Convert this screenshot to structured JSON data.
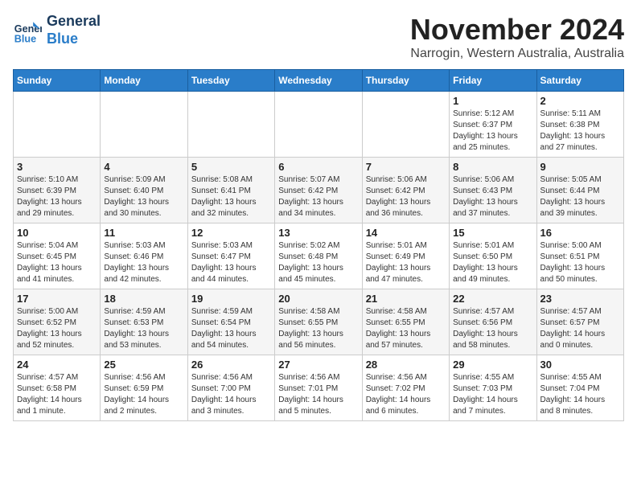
{
  "header": {
    "logo_line1": "General",
    "logo_line2": "Blue",
    "month": "November 2024",
    "location": "Narrogin, Western Australia, Australia"
  },
  "days_of_week": [
    "Sunday",
    "Monday",
    "Tuesday",
    "Wednesday",
    "Thursday",
    "Friday",
    "Saturday"
  ],
  "weeks": [
    [
      {
        "day": "",
        "info": ""
      },
      {
        "day": "",
        "info": ""
      },
      {
        "day": "",
        "info": ""
      },
      {
        "day": "",
        "info": ""
      },
      {
        "day": "",
        "info": ""
      },
      {
        "day": "1",
        "info": "Sunrise: 5:12 AM\nSunset: 6:37 PM\nDaylight: 13 hours\nand 25 minutes."
      },
      {
        "day": "2",
        "info": "Sunrise: 5:11 AM\nSunset: 6:38 PM\nDaylight: 13 hours\nand 27 minutes."
      }
    ],
    [
      {
        "day": "3",
        "info": "Sunrise: 5:10 AM\nSunset: 6:39 PM\nDaylight: 13 hours\nand 29 minutes."
      },
      {
        "day": "4",
        "info": "Sunrise: 5:09 AM\nSunset: 6:40 PM\nDaylight: 13 hours\nand 30 minutes."
      },
      {
        "day": "5",
        "info": "Sunrise: 5:08 AM\nSunset: 6:41 PM\nDaylight: 13 hours\nand 32 minutes."
      },
      {
        "day": "6",
        "info": "Sunrise: 5:07 AM\nSunset: 6:42 PM\nDaylight: 13 hours\nand 34 minutes."
      },
      {
        "day": "7",
        "info": "Sunrise: 5:06 AM\nSunset: 6:42 PM\nDaylight: 13 hours\nand 36 minutes."
      },
      {
        "day": "8",
        "info": "Sunrise: 5:06 AM\nSunset: 6:43 PM\nDaylight: 13 hours\nand 37 minutes."
      },
      {
        "day": "9",
        "info": "Sunrise: 5:05 AM\nSunset: 6:44 PM\nDaylight: 13 hours\nand 39 minutes."
      }
    ],
    [
      {
        "day": "10",
        "info": "Sunrise: 5:04 AM\nSunset: 6:45 PM\nDaylight: 13 hours\nand 41 minutes."
      },
      {
        "day": "11",
        "info": "Sunrise: 5:03 AM\nSunset: 6:46 PM\nDaylight: 13 hours\nand 42 minutes."
      },
      {
        "day": "12",
        "info": "Sunrise: 5:03 AM\nSunset: 6:47 PM\nDaylight: 13 hours\nand 44 minutes."
      },
      {
        "day": "13",
        "info": "Sunrise: 5:02 AM\nSunset: 6:48 PM\nDaylight: 13 hours\nand 45 minutes."
      },
      {
        "day": "14",
        "info": "Sunrise: 5:01 AM\nSunset: 6:49 PM\nDaylight: 13 hours\nand 47 minutes."
      },
      {
        "day": "15",
        "info": "Sunrise: 5:01 AM\nSunset: 6:50 PM\nDaylight: 13 hours\nand 49 minutes."
      },
      {
        "day": "16",
        "info": "Sunrise: 5:00 AM\nSunset: 6:51 PM\nDaylight: 13 hours\nand 50 minutes."
      }
    ],
    [
      {
        "day": "17",
        "info": "Sunrise: 5:00 AM\nSunset: 6:52 PM\nDaylight: 13 hours\nand 52 minutes."
      },
      {
        "day": "18",
        "info": "Sunrise: 4:59 AM\nSunset: 6:53 PM\nDaylight: 13 hours\nand 53 minutes."
      },
      {
        "day": "19",
        "info": "Sunrise: 4:59 AM\nSunset: 6:54 PM\nDaylight: 13 hours\nand 54 minutes."
      },
      {
        "day": "20",
        "info": "Sunrise: 4:58 AM\nSunset: 6:55 PM\nDaylight: 13 hours\nand 56 minutes."
      },
      {
        "day": "21",
        "info": "Sunrise: 4:58 AM\nSunset: 6:55 PM\nDaylight: 13 hours\nand 57 minutes."
      },
      {
        "day": "22",
        "info": "Sunrise: 4:57 AM\nSunset: 6:56 PM\nDaylight: 13 hours\nand 58 minutes."
      },
      {
        "day": "23",
        "info": "Sunrise: 4:57 AM\nSunset: 6:57 PM\nDaylight: 14 hours\nand 0 minutes."
      }
    ],
    [
      {
        "day": "24",
        "info": "Sunrise: 4:57 AM\nSunset: 6:58 PM\nDaylight: 14 hours\nand 1 minute."
      },
      {
        "day": "25",
        "info": "Sunrise: 4:56 AM\nSunset: 6:59 PM\nDaylight: 14 hours\nand 2 minutes."
      },
      {
        "day": "26",
        "info": "Sunrise: 4:56 AM\nSunset: 7:00 PM\nDaylight: 14 hours\nand 3 minutes."
      },
      {
        "day": "27",
        "info": "Sunrise: 4:56 AM\nSunset: 7:01 PM\nDaylight: 14 hours\nand 5 minutes."
      },
      {
        "day": "28",
        "info": "Sunrise: 4:56 AM\nSunset: 7:02 PM\nDaylight: 14 hours\nand 6 minutes."
      },
      {
        "day": "29",
        "info": "Sunrise: 4:55 AM\nSunset: 7:03 PM\nDaylight: 14 hours\nand 7 minutes."
      },
      {
        "day": "30",
        "info": "Sunrise: 4:55 AM\nSunset: 7:04 PM\nDaylight: 14 hours\nand 8 minutes."
      }
    ]
  ]
}
